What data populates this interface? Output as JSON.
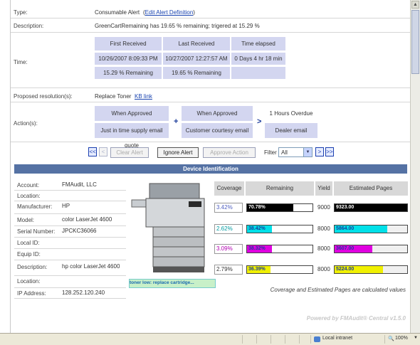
{
  "alert": {
    "type_label": "Type:",
    "type_value": "Consumable Alert",
    "edit_link": "Edit Alert Definition",
    "description_label": "Description:",
    "description_value": "GreenCartRemaining has 19.65 % remaining; trigered at 15.29 %",
    "time_label": "Time:",
    "time_headers": [
      "First Received",
      "Last Received",
      "Time elapsed"
    ],
    "first_received": "10/26/2007 8:09:33 PM",
    "last_received": "10/27/2007 12:27:57 AM",
    "time_elapsed": "0 Days 4 hr 18 min",
    "first_remaining": "15.29 % Remaining",
    "last_remaining": "19.65 % Remaining",
    "resolution_label": "Proposed resolution(s):",
    "resolution_value": "Replace Toner",
    "kb_link": "KB link",
    "actions_label": "Action(s):",
    "actions": [
      {
        "header": "When Approved",
        "value": "Just in time supply email quote"
      },
      {
        "header": "When Approved",
        "value": "Customer courtesy email"
      },
      {
        "header": "1 Hours Overdue",
        "value": "Dealer email"
      }
    ],
    "plus_symbol": "+",
    "arrow_symbol": ">"
  },
  "toolbar": {
    "first": "<<",
    "prev": "<",
    "clear_alert": "Clear Alert",
    "ignore_alert": "Ignore Alert",
    "approve_action": "Approve Action",
    "filter_label": "Filter",
    "filter_value": "All",
    "next": ">",
    "last": ">>"
  },
  "device": {
    "section_title": "Device Identification",
    "rows": [
      {
        "label": "Account:",
        "value": "FMAudit, LLC"
      },
      {
        "label": "Location:",
        "value": ""
      },
      {
        "label": "Manufacturer:",
        "value": "HP"
      },
      {
        "label": "Model:",
        "value": "color LaserJet 4600"
      },
      {
        "label": "Serial Number:",
        "value": "JPCKC36066"
      },
      {
        "label": "Local ID:",
        "value": ""
      },
      {
        "label": "Equip ID:",
        "value": ""
      },
      {
        "label": "Description:",
        "value": "hp color LaserJet 4600"
      },
      {
        "label": "Location:",
        "value": ""
      },
      {
        "label": "IP Address:",
        "value": "128.252.120.240"
      }
    ],
    "toner_message": "toner low: replace cartridge..."
  },
  "consumables": {
    "headers": [
      "Coverage",
      "Remaining",
      "Yield",
      "Estimated Pages"
    ],
    "items": [
      {
        "coverage": "3.42%",
        "remaining": "70.78%",
        "remaining_pct": 70.78,
        "yield": "9000",
        "pages": "9323.00",
        "pages_fraction": 1.0,
        "color": "#000000",
        "text_color": "#ffffff",
        "cov_color": "#5060c0"
      },
      {
        "coverage": "2.62%",
        "remaining": "38.42%",
        "remaining_pct": 38.42,
        "yield": "8000",
        "pages": "5864.00",
        "pages_fraction": 0.73,
        "color": "#00e0e8",
        "text_color": "#1a3b9a",
        "cov_color": "#009aa0"
      },
      {
        "coverage": "3.09%",
        "remaining": "38.32%",
        "remaining_pct": 38.32,
        "yield": "8000",
        "pages": "3607.00",
        "pages_fraction": 0.52,
        "color": "#e000e0",
        "text_color": "#1a3b9a",
        "cov_color": "#b000b0"
      },
      {
        "coverage": "2.79%",
        "remaining": "36.39%",
        "remaining_pct": 36.39,
        "yield": "8000",
        "pages": "5224.00",
        "pages_fraction": 0.67,
        "color": "#f0f000",
        "text_color": "#1a3b9a",
        "cov_color": "#333333"
      }
    ],
    "note": "Coverage and Estimated Pages are calculated values",
    "powered_by": "Powered by FMAudit® Central v1.5.0"
  },
  "statusbar": {
    "zone": "Local intranet",
    "zoom": "100%"
  }
}
